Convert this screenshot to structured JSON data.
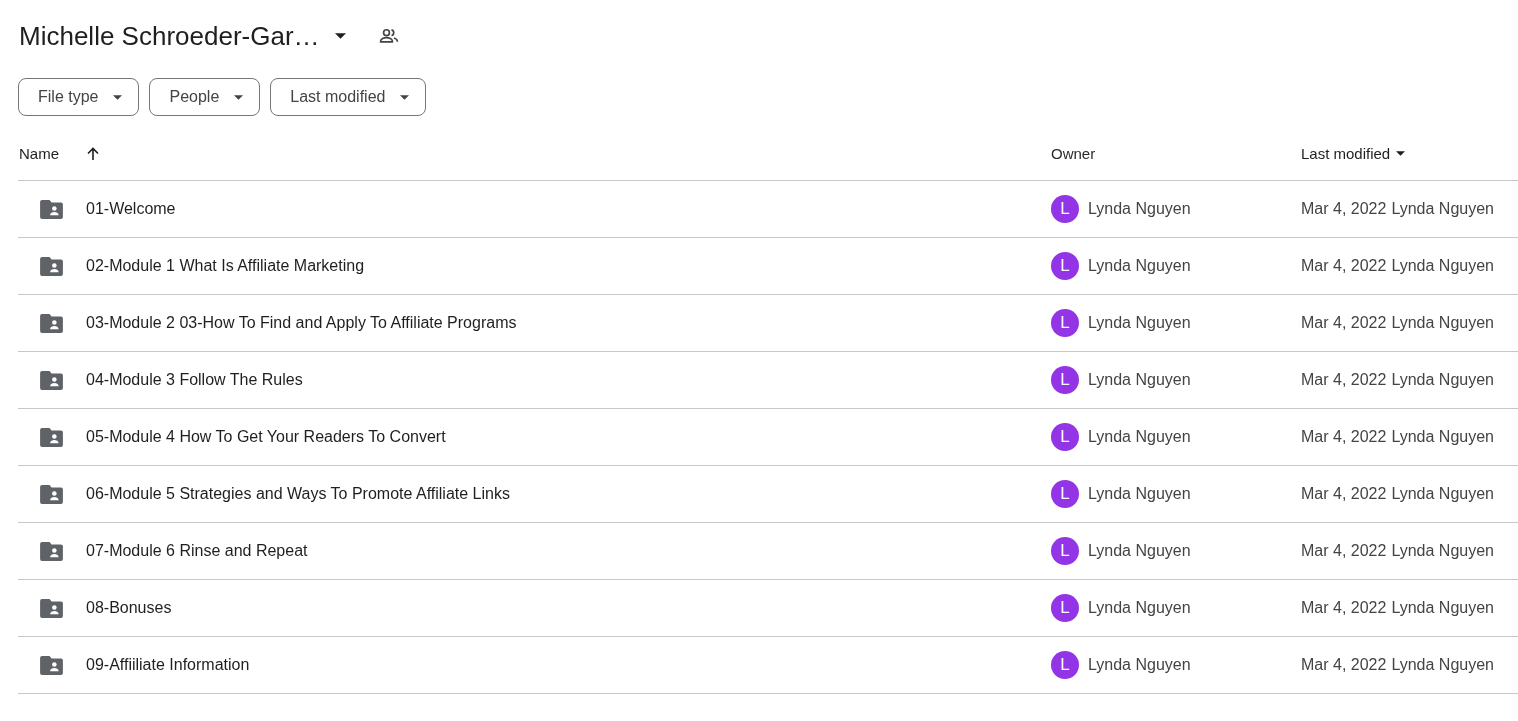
{
  "header": {
    "title": "Michelle Schroeder-Gar…"
  },
  "filters": [
    {
      "label": "File type"
    },
    {
      "label": "People"
    },
    {
      "label": "Last modified"
    }
  ],
  "table": {
    "columns": [
      {
        "label": "Name",
        "kind": "arrow",
        "sorted": true
      },
      {
        "label": "Owner",
        "kind": "plain",
        "sorted": false
      },
      {
        "label": "Last modified",
        "kind": "menu",
        "sorted": true
      }
    ],
    "rows": [
      {
        "name": "01-Welcome",
        "owner_initial": "L",
        "owner": "Lynda Nguyen",
        "date": "Mar 4, 2022",
        "modified_by": "Lynda Nguyen"
      },
      {
        "name": "02-Module 1 What Is Affiliate Marketing",
        "owner_initial": "L",
        "owner": "Lynda Nguyen",
        "date": "Mar 4, 2022",
        "modified_by": "Lynda Nguyen"
      },
      {
        "name": "03-Module 2 03-How To Find and Apply To Affiliate Programs",
        "owner_initial": "L",
        "owner": "Lynda Nguyen",
        "date": "Mar 4, 2022",
        "modified_by": "Lynda Nguyen"
      },
      {
        "name": "04-Module 3 Follow The Rules",
        "owner_initial": "L",
        "owner": "Lynda Nguyen",
        "date": "Mar 4, 2022",
        "modified_by": "Lynda Nguyen"
      },
      {
        "name": "05-Module 4 How To Get Your Readers To Convert",
        "owner_initial": "L",
        "owner": "Lynda Nguyen",
        "date": "Mar 4, 2022",
        "modified_by": "Lynda Nguyen"
      },
      {
        "name": "06-Module 5 Strategies and Ways To Promote Affiliate Links",
        "owner_initial": "L",
        "owner": "Lynda Nguyen",
        "date": "Mar 4, 2022",
        "modified_by": "Lynda Nguyen"
      },
      {
        "name": "07-Module 6 Rinse and Repeat",
        "owner_initial": "L",
        "owner": "Lynda Nguyen",
        "date": "Mar 4, 2022",
        "modified_by": "Lynda Nguyen"
      },
      {
        "name": "08-Bonuses",
        "owner_initial": "L",
        "owner": "Lynda Nguyen",
        "date": "Mar 4, 2022",
        "modified_by": "Lynda Nguyen"
      },
      {
        "name": "09-Affiiliate Information",
        "owner_initial": "L",
        "owner": "Lynda Nguyen",
        "date": "Mar 4, 2022",
        "modified_by": "Lynda Nguyen"
      }
    ]
  }
}
